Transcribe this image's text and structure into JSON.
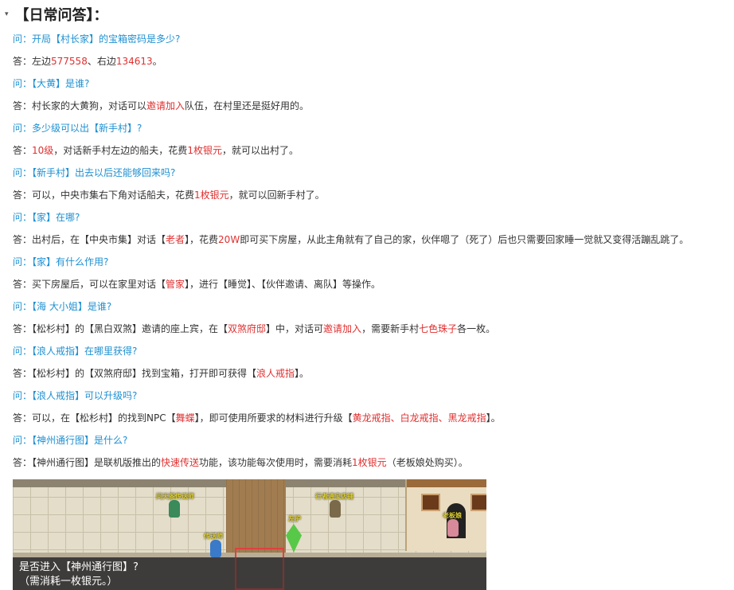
{
  "heading": {
    "caret": "▾",
    "title": "【日常问答】："
  },
  "qa": [
    {
      "type": "q",
      "parts": [
        {
          "t": "问：开局【村长家】的宝箱密码是多少?",
          "h": false
        }
      ]
    },
    {
      "type": "a",
      "parts": [
        {
          "t": "答：左边",
          "h": false
        },
        {
          "t": "577558",
          "h": true
        },
        {
          "t": "、右边",
          "h": false
        },
        {
          "t": "134613",
          "h": true
        },
        {
          "t": "。",
          "h": false
        }
      ]
    },
    {
      "type": "q",
      "parts": [
        {
          "t": "问：【大黄】是谁?",
          "h": false
        }
      ]
    },
    {
      "type": "a",
      "parts": [
        {
          "t": "答：村长家的大黄狗，对话可以",
          "h": false
        },
        {
          "t": "邀请加入",
          "h": true
        },
        {
          "t": "队伍，在村里还是挺好用的。",
          "h": false
        }
      ]
    },
    {
      "type": "q",
      "parts": [
        {
          "t": "问：多少级可以出【新手村】?",
          "h": false
        }
      ]
    },
    {
      "type": "a",
      "parts": [
        {
          "t": "答：",
          "h": false
        },
        {
          "t": "10级",
          "h": true
        },
        {
          "t": "，对话新手村左边的船夫，花费",
          "h": false
        },
        {
          "t": "1枚银元",
          "h": true
        },
        {
          "t": "，就可以出村了。",
          "h": false
        }
      ]
    },
    {
      "type": "q",
      "parts": [
        {
          "t": "问：【新手村】出去以后还能够回来吗?",
          "h": false
        }
      ]
    },
    {
      "type": "a",
      "parts": [
        {
          "t": "答：可以，中央市集右下角对话船夫，花费",
          "h": false
        },
        {
          "t": "1枚银元",
          "h": true
        },
        {
          "t": "，就可以回新手村了。",
          "h": false
        }
      ]
    },
    {
      "type": "q",
      "parts": [
        {
          "t": "问：【家】在哪?",
          "h": false
        }
      ]
    },
    {
      "type": "a",
      "parts": [
        {
          "t": "答：出村后，在【中央市集】对话【",
          "h": false
        },
        {
          "t": "老者",
          "h": true
        },
        {
          "t": "】，花费",
          "h": false
        },
        {
          "t": "20W",
          "h": true
        },
        {
          "t": "即可买下房屋，从此主角就有了自己的家，伙伴嗯了（死了）后也只需要回家睡一觉就又变得活蹦乱跳了。",
          "h": false
        }
      ]
    },
    {
      "type": "q",
      "parts": [
        {
          "t": "问：【家】有什么作用?",
          "h": false
        }
      ]
    },
    {
      "type": "a",
      "parts": [
        {
          "t": "答：买下房屋后，可以在家里对话【",
          "h": false
        },
        {
          "t": "管家",
          "h": true
        },
        {
          "t": "】，进行【睡觉】、【伙伴邀请、离队】等操作。",
          "h": false
        }
      ]
    },
    {
      "type": "q",
      "parts": [
        {
          "t": "问：【海 大小姐】是谁?",
          "h": false
        }
      ]
    },
    {
      "type": "a",
      "parts": [
        {
          "t": "答：【松杉村】的【黑白双煞】邀请的座上宾，在【",
          "h": false
        },
        {
          "t": "双煞府邸",
          "h": true
        },
        {
          "t": "】中，对话可",
          "h": false
        },
        {
          "t": "邀请加入",
          "h": true
        },
        {
          "t": "，需要新手村",
          "h": false
        },
        {
          "t": "七色珠子",
          "h": true
        },
        {
          "t": "各一枚。",
          "h": false
        }
      ]
    },
    {
      "type": "q",
      "parts": [
        {
          "t": "问：【浪人戒指】在哪里获得?",
          "h": false
        }
      ]
    },
    {
      "type": "a",
      "parts": [
        {
          "t": "答：【松杉村】的【双煞府邸】找到宝箱，打开即可获得【",
          "h": false
        },
        {
          "t": "浪人戒指",
          "h": true
        },
        {
          "t": "】。",
          "h": false
        }
      ]
    },
    {
      "type": "q",
      "parts": [
        {
          "t": "问：【浪人戒指】可以升级吗?",
          "h": false
        }
      ]
    },
    {
      "type": "a",
      "parts": [
        {
          "t": "答：可以，在【松杉村】的找到NPC【",
          "h": false
        },
        {
          "t": "舞蝶",
          "h": true
        },
        {
          "t": "】，即可使用所要求的材料进行升级【",
          "h": false
        },
        {
          "t": "黄龙戒指、白龙戒指、黑龙戒指",
          "h": true
        },
        {
          "t": "】。",
          "h": false
        }
      ]
    },
    {
      "type": "q",
      "parts": [
        {
          "t": "问：【神州通行图】是什么?",
          "h": false
        }
      ]
    },
    {
      "type": "a",
      "parts": [
        {
          "t": "答：【神州通行图】是联机版推出的",
          "h": false
        },
        {
          "t": "快速传送",
          "h": true
        },
        {
          "t": "功能，该功能每次使用时，需要消耗",
          "h": false
        },
        {
          "t": "1枚银元",
          "h": true
        },
        {
          "t": "（老板娘处购买）。",
          "h": false
        }
      ]
    }
  ],
  "game": {
    "npc_labels": [
      "问天阁传送师",
      "行者通宝店铺",
      "左护",
      "老板娘",
      "传送师"
    ],
    "dialog_line1": "是否进入【神州通行图】?",
    "dialog_line2": "（需消耗一枚银元。）"
  },
  "colors": {
    "question": "#1e90d2",
    "answer": "#333333",
    "highlight": "#e03030"
  }
}
